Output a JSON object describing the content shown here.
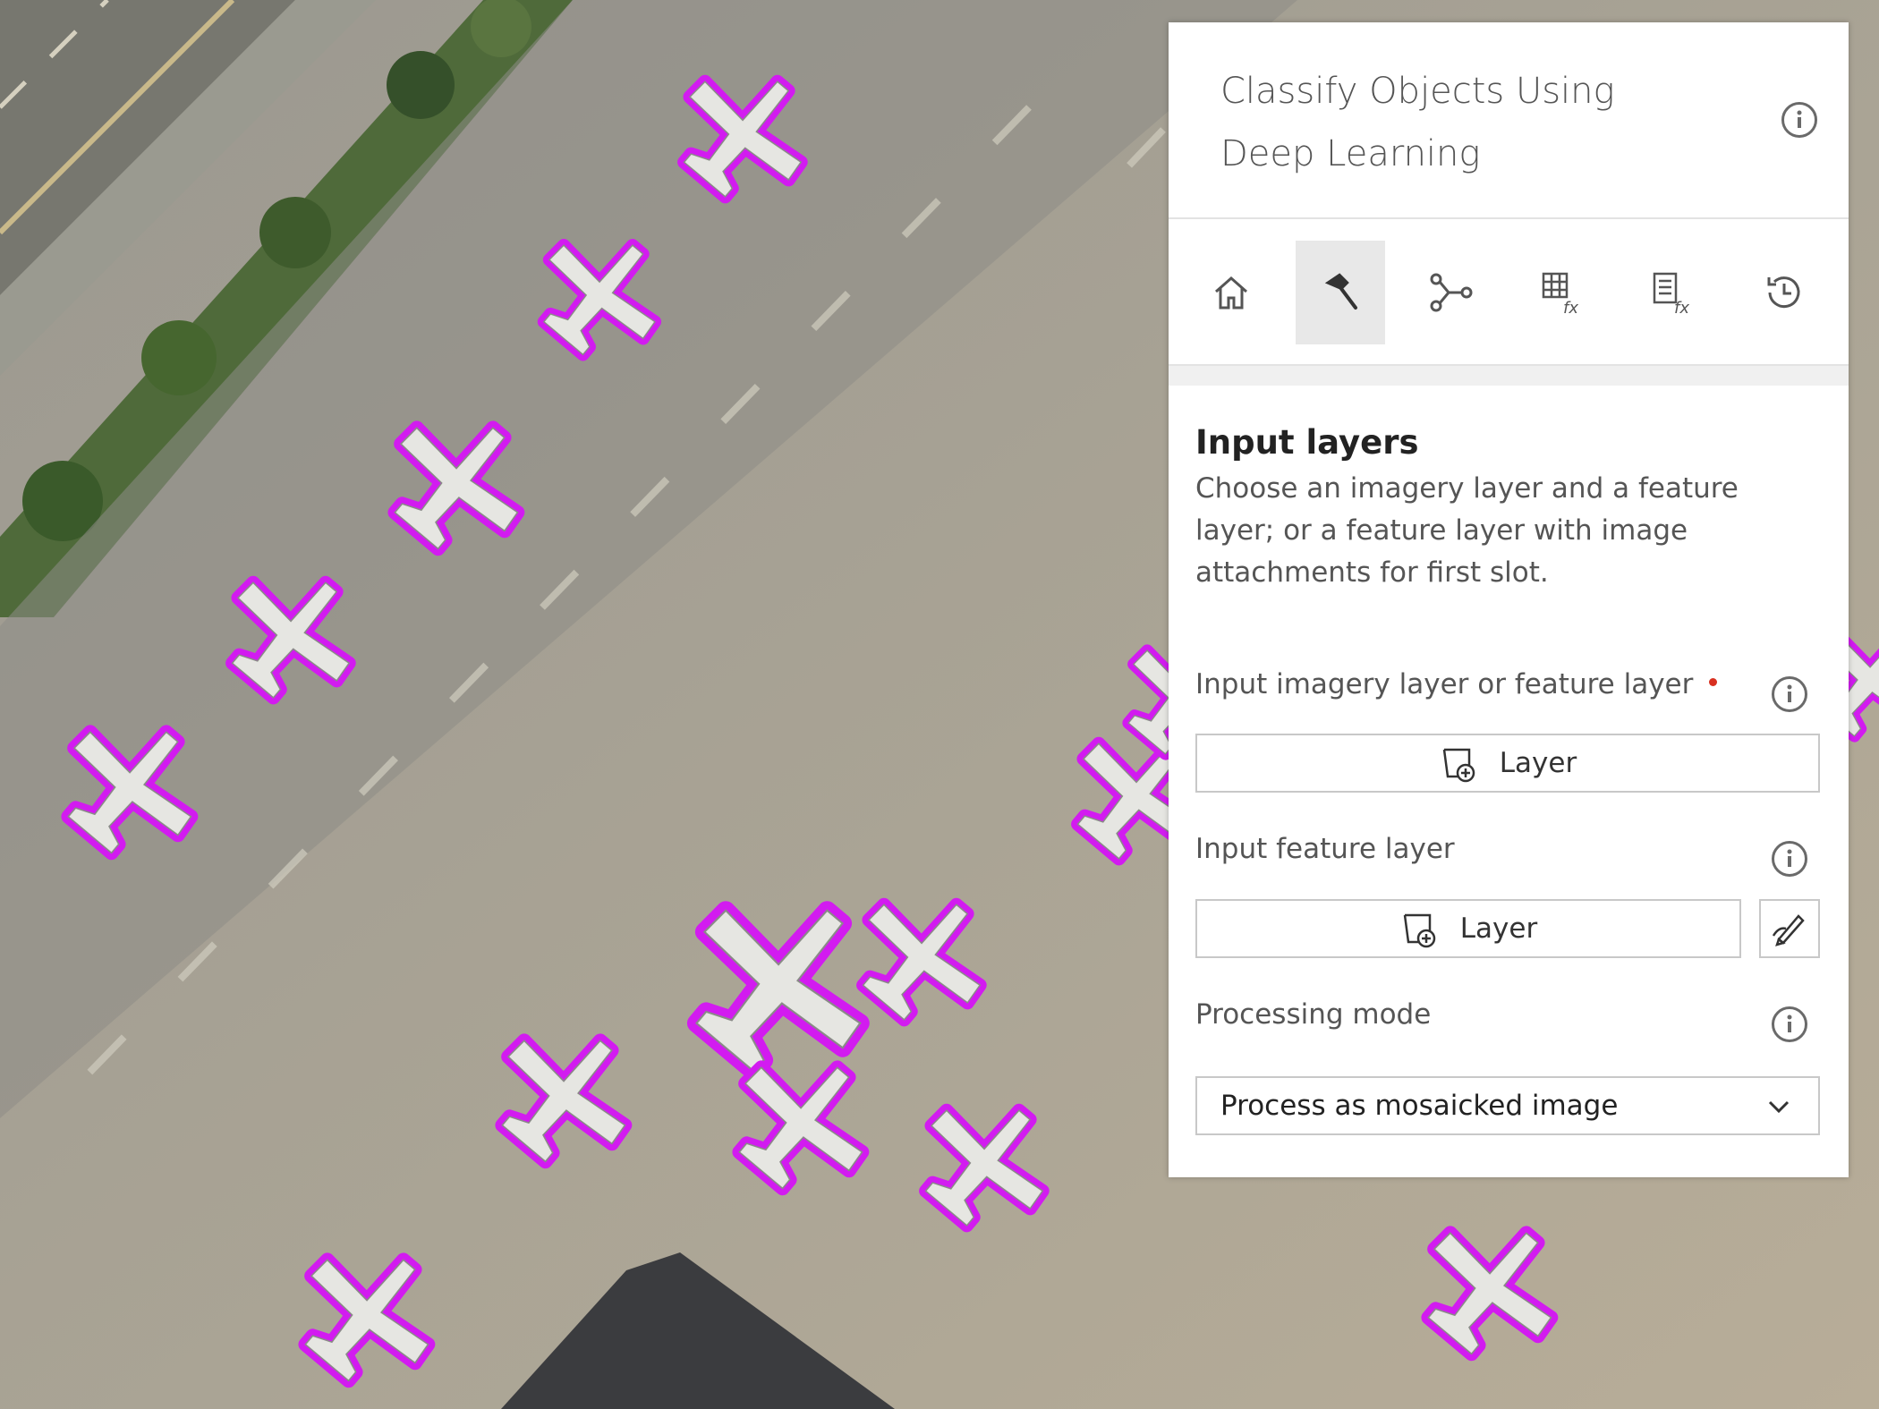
{
  "panel": {
    "title_line1": "Classify Objects Using",
    "title_line2": "Deep Learning",
    "toolbar": [
      {
        "name": "home",
        "icon": "home-icon",
        "active": false
      },
      {
        "name": "tool",
        "icon": "hammer-icon",
        "active": true
      },
      {
        "name": "model",
        "icon": "node-graph-icon",
        "active": false
      },
      {
        "name": "raster-function",
        "icon": "grid-fx-icon",
        "active": false
      },
      {
        "name": "list-function",
        "icon": "list-fx-icon",
        "active": false
      },
      {
        "name": "history",
        "icon": "history-icon",
        "active": false
      }
    ],
    "section": {
      "title": "Input layers",
      "description": "Choose an imagery layer and a feature layer; or a feature layer with image attachments for first slot."
    },
    "fields": {
      "input_imagery": {
        "label": "Input imagery layer or feature layer",
        "required": true,
        "button_label": "Layer"
      },
      "input_feature": {
        "label": "Input feature layer",
        "button_label": "Layer"
      },
      "processing_mode": {
        "label": "Processing mode",
        "value": "Process as mosaicked image"
      }
    }
  },
  "colors": {
    "detection_outline": "#d21bf0",
    "required_dot": "#d83020",
    "panel_bg": "#ffffff"
  }
}
